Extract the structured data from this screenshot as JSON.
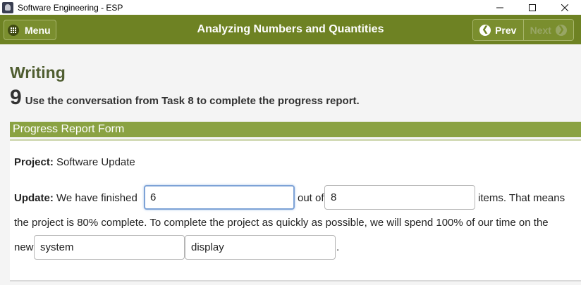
{
  "window": {
    "title": "Software Engineering - ESP",
    "controls": {
      "minimize": "—",
      "maximize": "☐",
      "close": "✕"
    }
  },
  "header": {
    "menu_label": "Menu",
    "title": "Analyzing Numbers and Quantities",
    "prev_label": "Prev",
    "next_label": "Next"
  },
  "content": {
    "section_title": "Writing",
    "task_number": "9",
    "task_instruction": "Use the conversation from Task 8 to complete the progress report.",
    "form_title": "Progress Report Form",
    "project_label": "Project:",
    "project_value": "Software Update",
    "update_label": "Update:",
    "text_we_have_finished": "We have finished",
    "field_finished_value": "6",
    "text_out_of": "out of",
    "field_total_value": "8",
    "text_items": "items. That means",
    "text_line2": "the project is 80% complete. To complete the project as quickly as possible, we will spend 100% of our time on the",
    "text_new": "new",
    "field_word1_value": "system",
    "field_word2_value": "display",
    "text_period": "."
  },
  "colors": {
    "header_green": "#6e8223",
    "form_bar_green": "#8aa242",
    "section_title": "#4f5d30",
    "focus_blue": "#7da2d6"
  }
}
